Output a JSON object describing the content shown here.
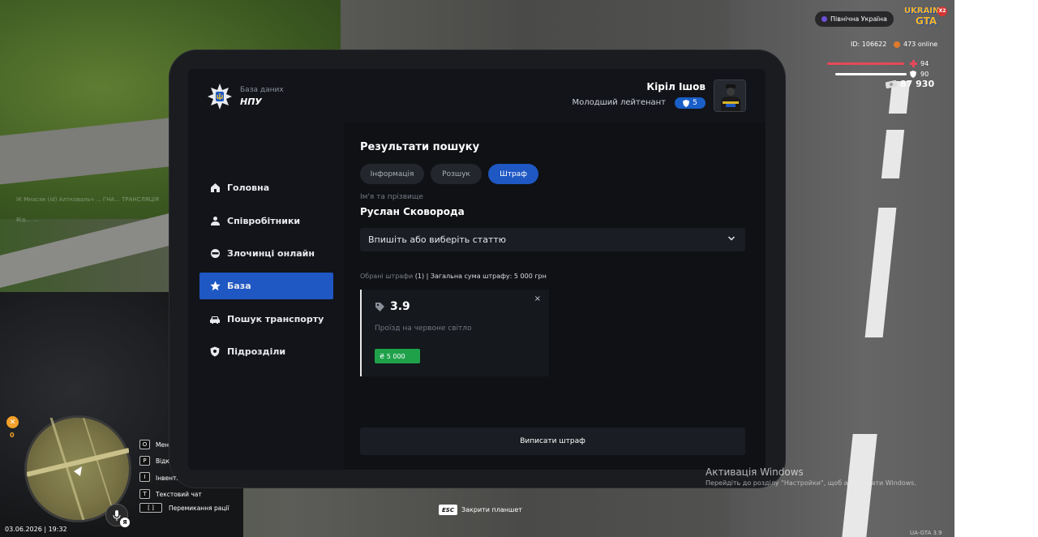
{
  "brand": {
    "subtitle": "База даних",
    "title": "НПУ"
  },
  "nav": [
    {
      "label": "Головна",
      "icon": "home-icon",
      "active": false
    },
    {
      "label": "Співробітники",
      "icon": "users-icon",
      "active": false
    },
    {
      "label": "Злочинці онлайн",
      "icon": "mask-icon",
      "active": false
    },
    {
      "label": "База",
      "icon": "star-icon",
      "active": true
    },
    {
      "label": "Пошук транспорту",
      "icon": "car-icon",
      "active": false
    },
    {
      "label": "Підрозділи",
      "icon": "shield-icon",
      "active": false
    }
  ],
  "user": {
    "name": "Кіріл Ішов",
    "rank": "Молодший лейтенант",
    "rank_level": "5"
  },
  "main": {
    "title": "Результати пошуку",
    "tabs": [
      {
        "label": "Інформація",
        "active": false
      },
      {
        "label": "Розшук",
        "active": false
      },
      {
        "label": "Штраф",
        "active": true
      }
    ],
    "name_label": "Ім'я та прізвище",
    "name_value": "Руслан Сковорода",
    "article_select_placeholder": "Впишіть або виберіть статтю",
    "summary_prefix": "Обрані штрафи",
    "summary_rest": "(1) | Загальна сума штрафу: 5 000 грн",
    "fine": {
      "code": "3.9",
      "description": "Проїзд на червоне світло",
      "amount": "₴ 5 000",
      "close": "×"
    },
    "submit_label": "Виписати штраф"
  },
  "hud": {
    "region": "Північна Україна",
    "logo_top": "UKRAINE",
    "logo_bottom": "GTA",
    "logo_badge": "X2",
    "player_id": "ID: 106622",
    "online": "473 online",
    "health": "94",
    "health_fraction": 0.97,
    "armor": "90",
    "armor_fraction": 0.9,
    "money": "87 930",
    "wanted": "0",
    "date_time": "03.06.2026 | 19:32",
    "lang": "Я",
    "keys": [
      {
        "key": "O",
        "label": "Мен"
      },
      {
        "key": "P",
        "label": "Відк"
      },
      {
        "key": "I",
        "label": "Інвент."
      },
      {
        "key": "T",
        "label": "Текстовий чат"
      },
      {
        "key": "[ ]",
        "label": "Перемикання рації"
      }
    ],
    "esc_key": "ESC",
    "esc_label": "Закрити планшет",
    "version": "UA-GTA 3.9",
    "feed": [
      "ІК Мнасяк (id) Алтковальч ... ГНА... ТРАНСЛЯЦІЯ",
      "Від... ..."
    ]
  },
  "os": {
    "activation_title": "Активація Windows",
    "activation_sub": "Перейдіть до розділу \"Настройки\", щоб активувати Windows."
  },
  "colors": {
    "accent": "#1f57c3",
    "success": "#1fa14a",
    "health": "#e8475a",
    "armor": "#ffffff"
  }
}
